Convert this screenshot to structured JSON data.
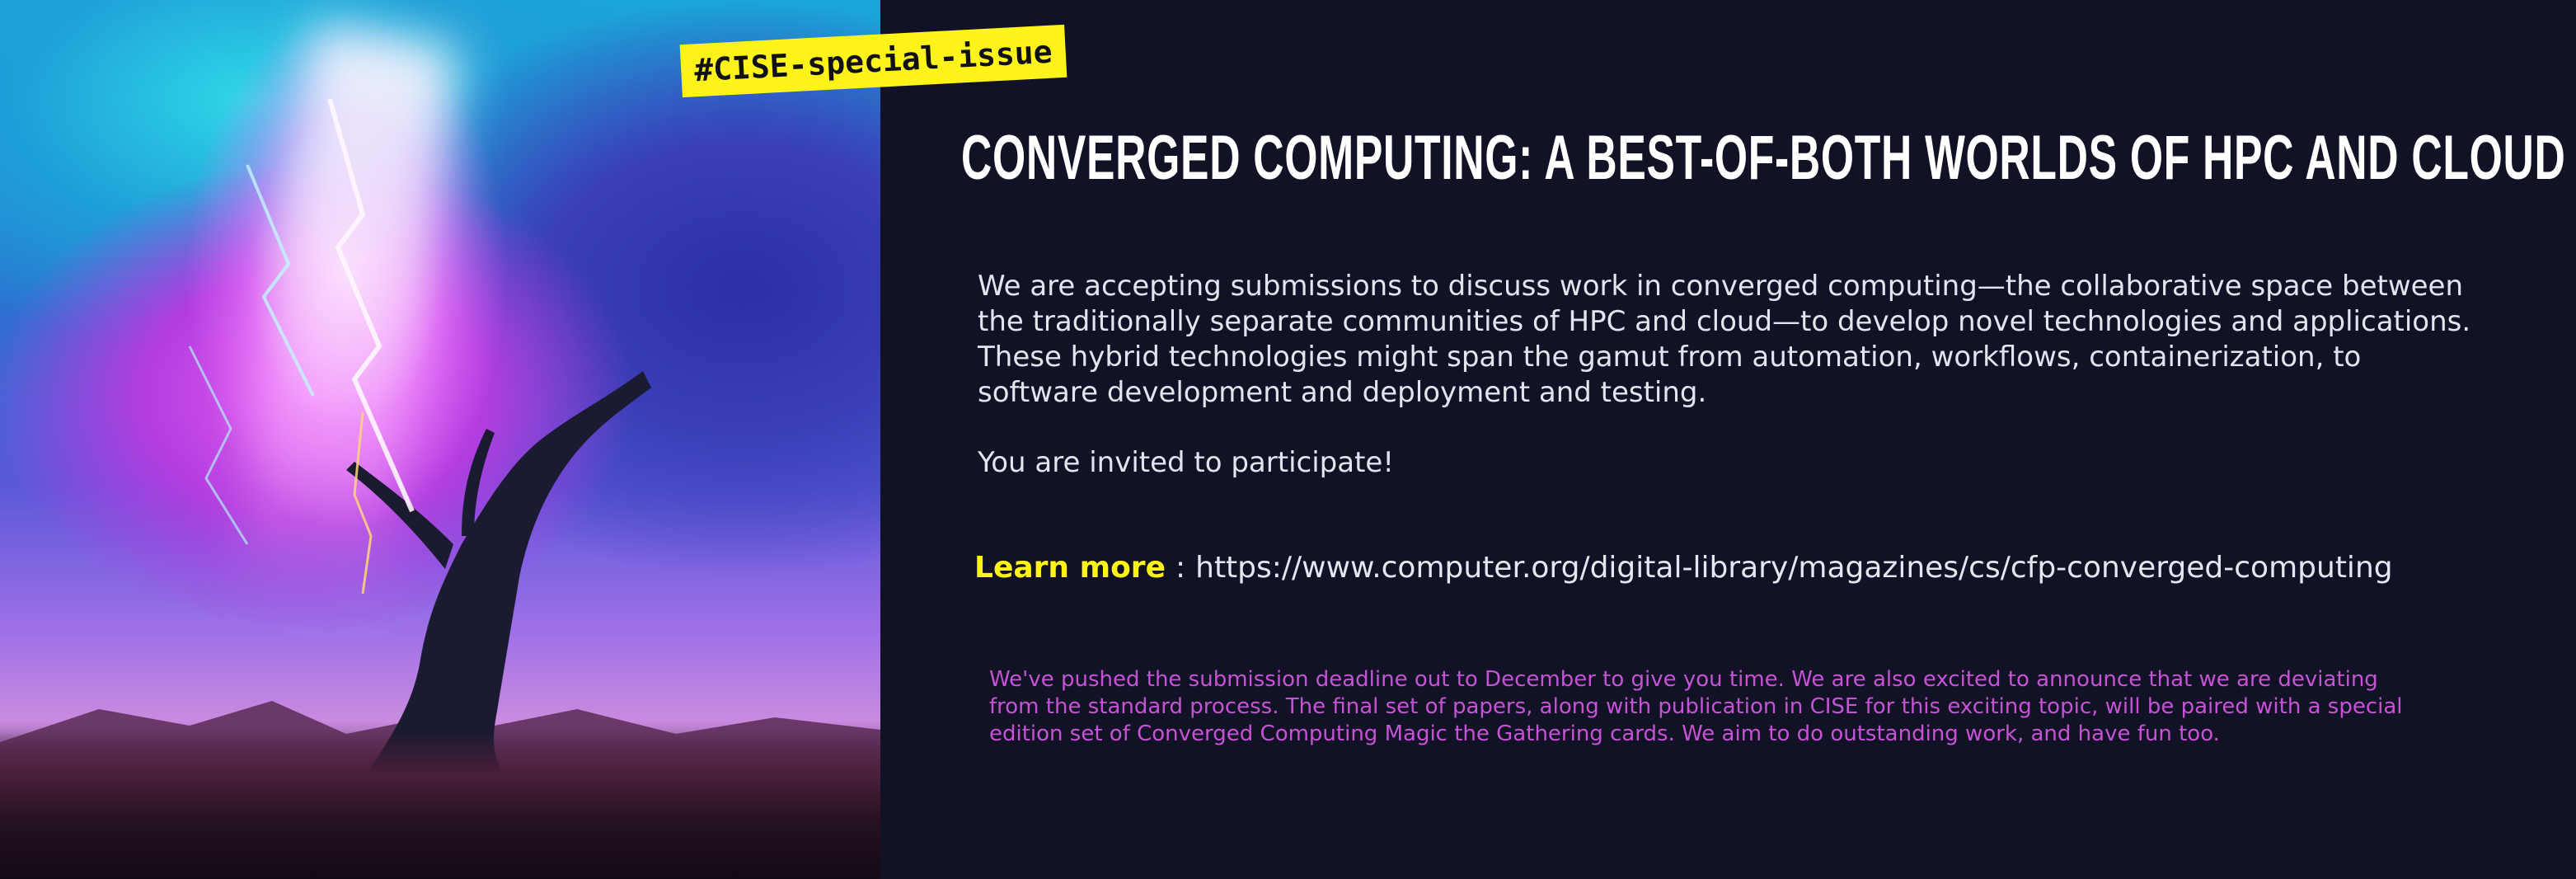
{
  "hashtag": "#CISE-special-issue",
  "title": "CONVERGED COMPUTING: A BEST-OF-BOTH WORLDS OF HPC AND CLOUD",
  "description": "We are accepting submissions to discuss work in converged computing—the collaborative space between the traditionally separate communities of HPC and cloud—to develop novel technologies and applications. These hybrid technologies might span the gamut from automation, workflows, containerization, to software development and deployment and testing.",
  "invite": "You are invited to participate!",
  "learn_more": {
    "label": "Learn more",
    "separator": ":",
    "url": "https://www.computer.org/digital-library/magazines/cs/cfp-converged-computing"
  },
  "note": "We've pushed the submission deadline out to December to give you time. We are also excited to announce that we are deviating from the standard process. The final set of papers, along with publication in CISE for this exciting topic, will be paired with a special edition set of Converged Computing Magic the Gathering cards. We aim to do outstanding work, and have fun too.",
  "colors": {
    "background": "#111225",
    "accent_yellow": "#fff31a",
    "note_magenta": "#c653d6",
    "text": "#e4e4ee"
  }
}
